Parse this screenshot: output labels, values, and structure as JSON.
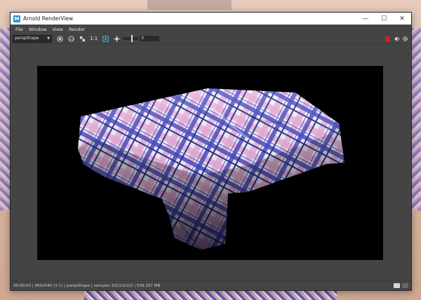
{
  "window": {
    "title": "Arnold RenderView",
    "app_icon_letter": "M",
    "controls": {
      "minimize": "—",
      "maximize": "☐",
      "close": "✕"
    }
  },
  "menu": [
    "File",
    "Window",
    "View",
    "Render"
  ],
  "toolbar": {
    "camera": "perspShape",
    "ratio_label": "1:1",
    "exposure_value": "0",
    "icons": [
      "display-settings-icon",
      "aov-icon",
      "color-picker-icon",
      "crop-region-icon",
      "exposure-icon"
    ]
  },
  "render": {
    "subject": "plaid tablecloth draped over table",
    "colors": {
      "blue": "#4b4fc9",
      "pink": "#e4a6d4",
      "white": "#ffffff",
      "navy": "#2a2b8c",
      "background": "#000000"
    }
  },
  "status": {
    "text": "00:00:03 | 960x540 (1:1) | perspShape  | samples 3/2/2/2/2/2 | 539.207 MB"
  },
  "accent": {
    "stop_render": "#d81f1f"
  }
}
